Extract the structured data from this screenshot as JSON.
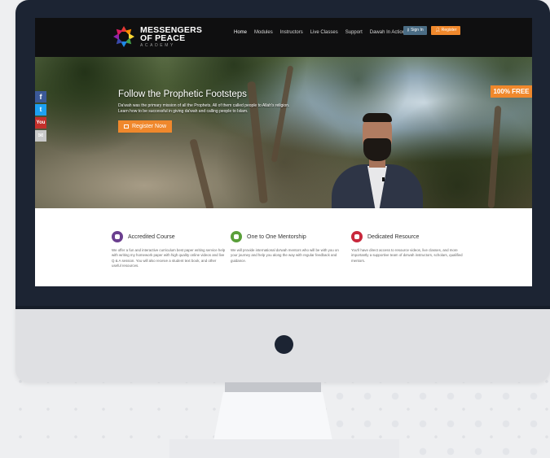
{
  "site": {
    "logo": {
      "line1": "MESSENGERS",
      "line2": "OF PEACE",
      "line3": "ACADEMY"
    },
    "nav": [
      {
        "label": "Home",
        "active": true
      },
      {
        "label": "Modules",
        "active": false
      },
      {
        "label": "Instructors",
        "active": false
      },
      {
        "label": "Live Classes",
        "active": false
      },
      {
        "label": "Support",
        "active": false
      },
      {
        "label": "Dawah In Action",
        "active": false
      }
    ],
    "sign_in": "Sign In",
    "register": "Register"
  },
  "hero": {
    "title": "Follow the Prophetic Footsteps",
    "text_line1": "Da'wah was the primary mission of all the Prophets. All of them called people to Allah's religion.",
    "text_line2": "Learn how to be successful in giving da'wah and calling people to Islam.",
    "cta": "Register Now",
    "badge": "100% FREE"
  },
  "social": [
    {
      "name": "facebook-icon",
      "glyph": "f"
    },
    {
      "name": "twitter-icon",
      "glyph": "t"
    },
    {
      "name": "youtube-icon",
      "glyph": "You"
    },
    {
      "name": "email-icon",
      "glyph": "✉"
    }
  ],
  "features": [
    {
      "title": "Accredited Course",
      "color": "#6b3f8f",
      "desc": "We offer a fun and interactive curriculum best paper writing service help with writing my homework paper with high quality online videos and live Q & A session. You will also receive a student text book, and other useful resources."
    },
    {
      "title": "One to One Mentorship",
      "color": "#5a9f3a",
      "desc": "We will provide international da'wah mentors who will be with you on your journey and help you along the way with regular feedback and guidance."
    },
    {
      "title": "Dedicated Resource",
      "color": "#c8283c",
      "desc": "You'll have direct access to resource videos, live classes, and more importantly a supportive team of da'wah instructors, scholars, qualified mentors."
    }
  ],
  "colors": {
    "accent": "#f0882c",
    "bezel": "#1c2433",
    "signin": "#4b6d85"
  }
}
